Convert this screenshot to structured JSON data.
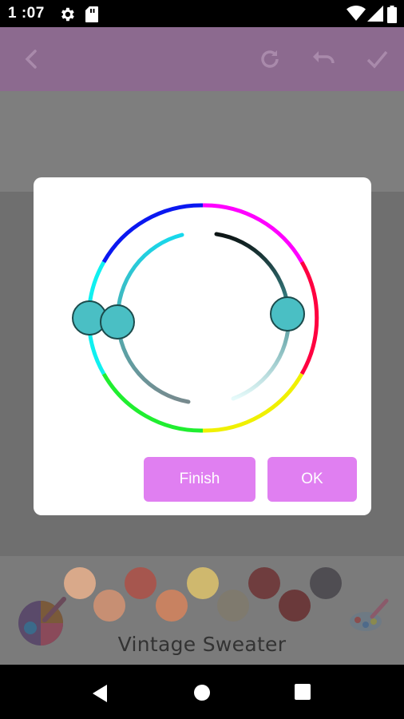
{
  "status_bar": {
    "time": "1 :07",
    "icons": [
      "settings-icon",
      "sd-card-icon",
      "wifi-icon",
      "signal-icon",
      "battery-icon"
    ]
  },
  "app_bar": {
    "icons": [
      "back-icon",
      "redo-icon",
      "undo-icon",
      "check-icon"
    ]
  },
  "dialog": {
    "finish_label": "Finish",
    "ok_label": "OK",
    "accent": "#e07ff1",
    "thumb_color": "#4abfc4"
  },
  "palette": {
    "title": "Vintage Sweater",
    "swatches": [
      "#d9a98a",
      "#a6564e",
      "#cfb86e",
      "#6f3d3e",
      "#4f4d52",
      "#c78f73",
      "#c88261",
      "#7f7a6e",
      "#6a393a"
    ]
  },
  "nav_bar": {
    "icons": [
      "back-triangle-icon",
      "home-circle-icon",
      "recents-square-icon"
    ]
  }
}
